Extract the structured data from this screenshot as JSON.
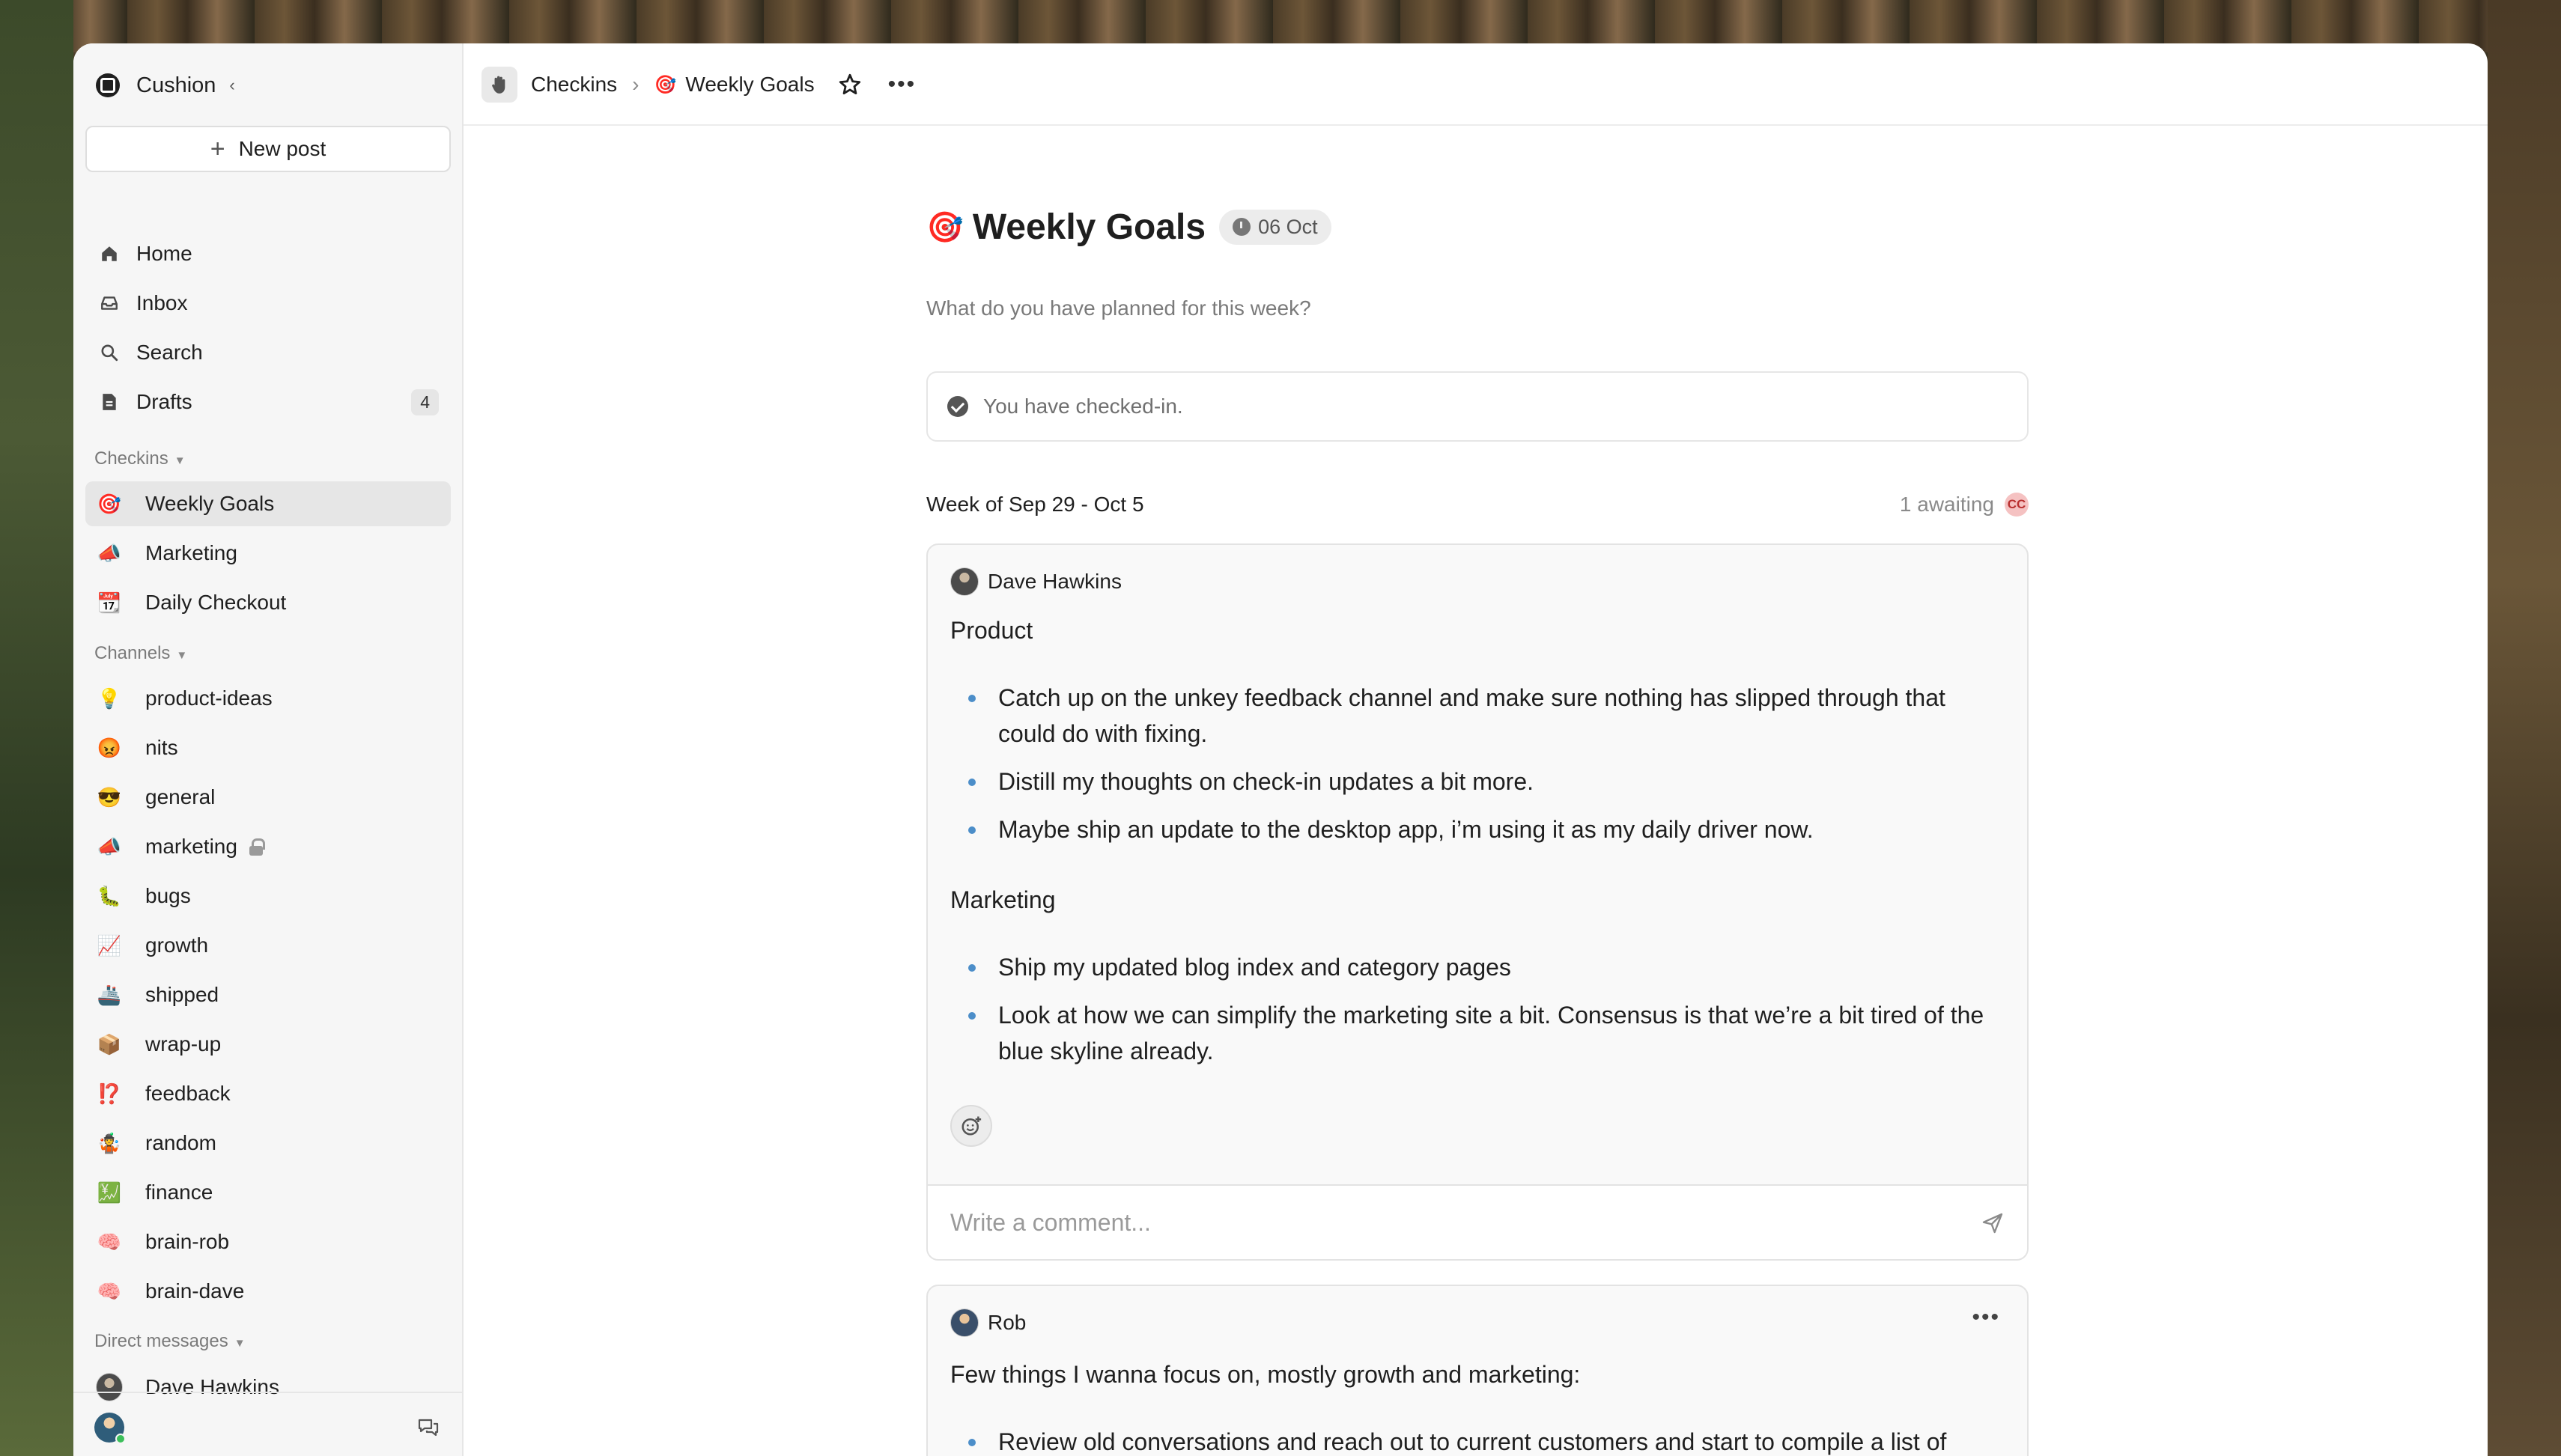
{
  "workspace": {
    "name": "Cushion"
  },
  "sidebar": {
    "new_post": "New post",
    "nav": [
      {
        "label": "Home",
        "icon": "home-icon"
      },
      {
        "label": "Inbox",
        "icon": "inbox-icon"
      },
      {
        "label": "Search",
        "icon": "search-icon"
      },
      {
        "label": "Drafts",
        "icon": "drafts-icon",
        "count": "4"
      }
    ],
    "checkins_header": "Checkins",
    "checkins": [
      {
        "label": "Weekly Goals",
        "emoji": "🎯",
        "active": true
      },
      {
        "label": "Marketing",
        "emoji": "📣"
      },
      {
        "label": "Daily Checkout",
        "emoji": "📆"
      }
    ],
    "channels_header": "Channels",
    "channels": [
      {
        "label": "product-ideas",
        "emoji": "💡"
      },
      {
        "label": "nits",
        "emoji": "😡"
      },
      {
        "label": "general",
        "emoji": "😎"
      },
      {
        "label": "marketing",
        "emoji": "📣",
        "locked": true
      },
      {
        "label": "bugs",
        "emoji": "🐛"
      },
      {
        "label": "growth",
        "emoji": "📈"
      },
      {
        "label": "shipped",
        "emoji": "🚢"
      },
      {
        "label": "wrap-up",
        "emoji": "📦"
      },
      {
        "label": "feedback",
        "emoji": "⁉️"
      },
      {
        "label": "random",
        "emoji": "🤹"
      },
      {
        "label": "finance",
        "emoji": "💹"
      },
      {
        "label": "brain-rob",
        "emoji": "🧠"
      },
      {
        "label": "brain-dave",
        "emoji": "🧠"
      }
    ],
    "dm_header": "Direct messages",
    "dms": [
      {
        "label": "Dave Hawkins"
      }
    ]
  },
  "breadcrumb": {
    "parent": "Checkins",
    "current": "Weekly Goals",
    "current_emoji": "🎯"
  },
  "page": {
    "emoji": "🎯",
    "title": "Weekly Goals",
    "date": "06 Oct",
    "subtitle": "What do you have planned for this week?",
    "checked_in": "You have checked-in.",
    "week_label": "Week of Sep 29 - Oct 5",
    "awaiting": "1 awaiting",
    "awaiting_initials": "CC"
  },
  "posts": [
    {
      "author": "Dave Hawkins",
      "sections": [
        {
          "heading": "Product",
          "items": [
            "Catch up on the unkey feedback channel and make sure nothing has slipped through that could do with fixing.",
            "Distill my thoughts on check-in updates a bit more.",
            "Maybe ship an update to the desktop app, i’m using it as my daily driver now."
          ]
        },
        {
          "heading": "Marketing",
          "items": [
            "Ship my updated blog index and category pages",
            "Look at how we can simplify the marketing site a bit. Consensus is that we’re a bit tired of the blue skyline already."
          ]
        }
      ],
      "comment_placeholder": "Write a comment..."
    },
    {
      "author": "Rob",
      "intro": "Few things I wanna focus on, mostly growth and marketing:",
      "items": [
        "Review old conversations and reach out to current customers and start to compile a list of reasons why people decided to try/buy Cushion. Think it’ll help for how people think"
      ]
    }
  ],
  "colors": {
    "accent_bullet": "#4c8ec9",
    "active_item_bg": "#e6e6e6",
    "awaiting_badge": "#f5c2c2"
  }
}
